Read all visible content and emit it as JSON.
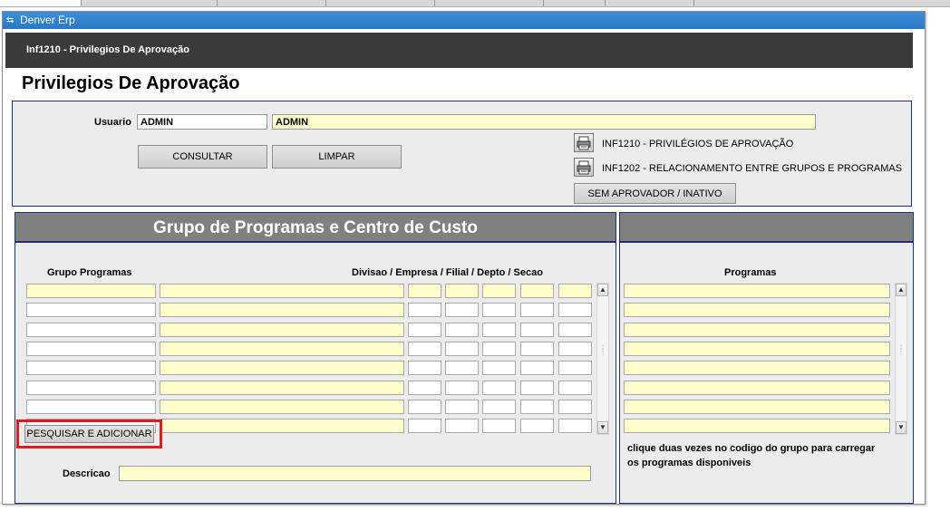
{
  "window": {
    "title": "Denver Erp"
  },
  "header": {
    "program_title": "Inf1210 - Privilegios De Aprovação"
  },
  "page": {
    "title": "Privilegios De Aprovação"
  },
  "filter": {
    "usuario_label": "Usuario",
    "usuario_code": "ADMIN",
    "usuario_name": "ADMIN",
    "consultar_label": "CONSULTAR",
    "limpar_label": "LIMPAR"
  },
  "reports": {
    "report1": "INF1210 - PRIVILÉGIOS DE APROVAÇÃO",
    "report2": "INF1202 - RELACIONAMENTO ENTRE GRUPOS E PROGRAMAS",
    "sem_aprovador_label": "SEM APROVADOR / INATIVO"
  },
  "group_panel": {
    "title": "Grupo de Programas e Centro de Custo",
    "col_grupo": "Grupo Programas",
    "col_divisao": "Divisao / Empresa / Filial / Depto / Secao",
    "rows": [
      "",
      "",
      "",
      "",
      "",
      "",
      "",
      ""
    ],
    "pesquisar_label": "PESQUISAR E ADICIONAR",
    "descricao_label": "Descricao",
    "descricao_value": ""
  },
  "programs_panel": {
    "title": "",
    "col_programas": "Programas",
    "rows": [
      "",
      "",
      "",
      "",
      "",
      "",
      "",
      ""
    ],
    "help_line1": "clique duas vezes no codigo do grupo para carregar",
    "help_line2": "os programas disponiveis"
  },
  "colors": {
    "field_yellow": "#ffffcc",
    "panel_head": "#808080",
    "title_blue": "#2a78c6",
    "highlight": "#e01b1b"
  },
  "icons": [
    "app-icon",
    "printer-icon",
    "scroll-up-icon",
    "scroll-down-icon"
  ]
}
